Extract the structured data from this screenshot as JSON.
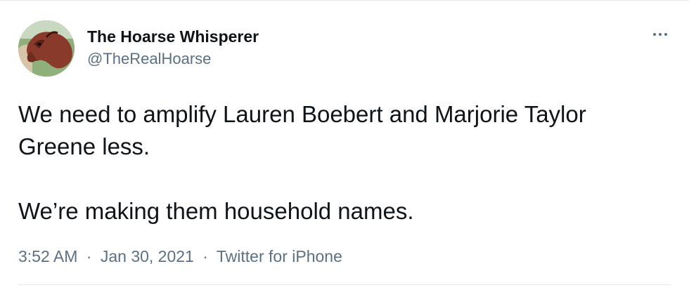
{
  "author": {
    "display_name": "The Hoarse Whisperer",
    "handle": "@TheRealHoarse",
    "avatar_icon": "horse-avatar"
  },
  "more_icon": "ellipsis-icon",
  "tweet": {
    "paragraphs": [
      "We need to amplify Lauren Boebert and Marjorie Taylor Greene less.",
      "We’re making them household names."
    ]
  },
  "meta": {
    "time": "3:52 AM",
    "date": "Jan 30, 2021",
    "source": "Twitter for iPhone",
    "separator": "·"
  },
  "colors": {
    "text": "#0f1419",
    "secondary": "#5b7083",
    "border": "#e1e8ed"
  }
}
